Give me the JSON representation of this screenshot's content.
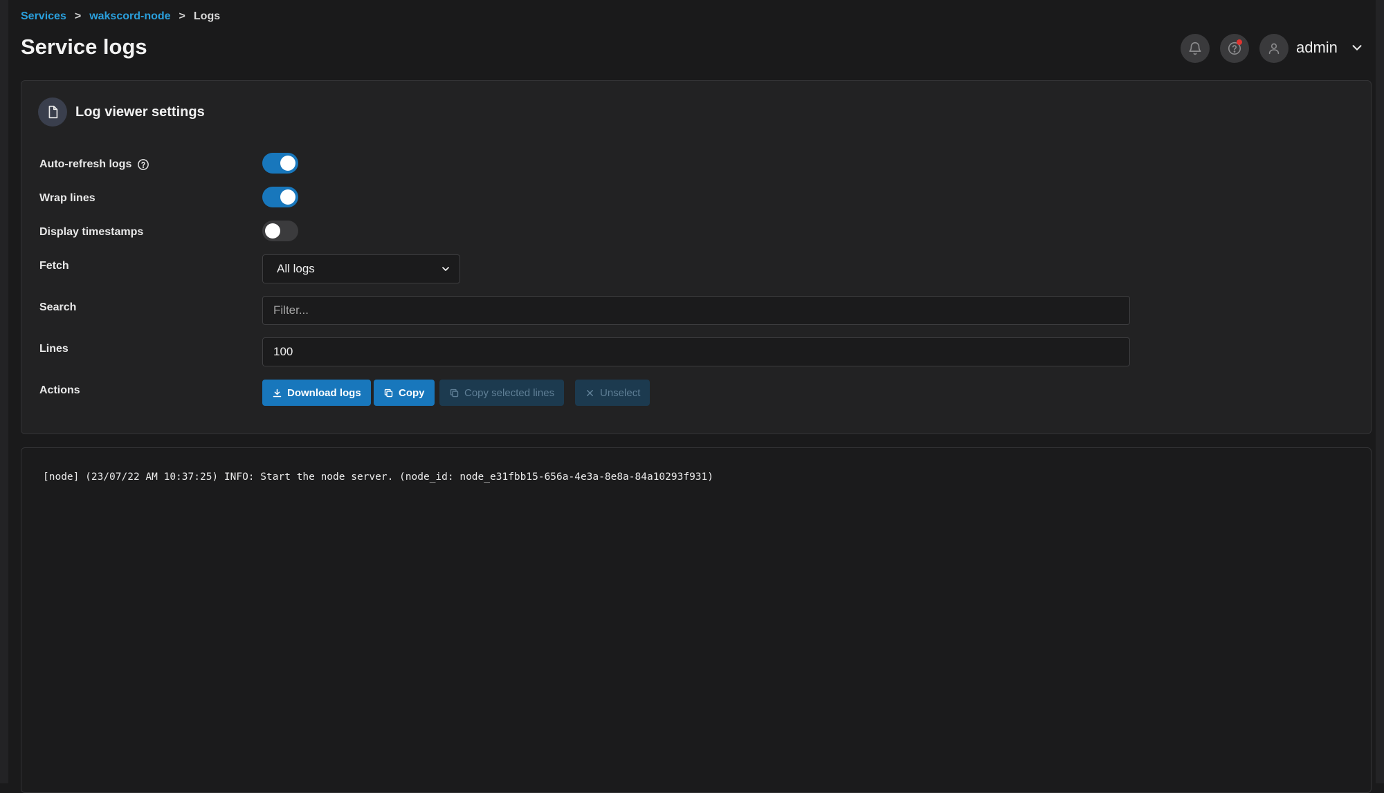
{
  "breadcrumb": {
    "items": [
      "Services",
      "wakscord-node"
    ],
    "separator": ">",
    "current": "Logs"
  },
  "header": {
    "title": "Service logs",
    "user": "admin",
    "icons": [
      "bell-icon",
      "help-circle-icon",
      "user-icon",
      "chevron-down-icon"
    ],
    "notification_color": "#e0342f"
  },
  "settings": {
    "title": "Log viewer settings",
    "auto_refresh": {
      "label": "Auto-refresh logs",
      "enabled": true
    },
    "wrap_lines": {
      "label": "Wrap lines",
      "enabled": true
    },
    "timestamps": {
      "label": "Display timestamps",
      "enabled": false
    },
    "fetch": {
      "label": "Fetch",
      "value": "All logs"
    },
    "search": {
      "label": "Search",
      "placeholder": "Filter...",
      "value": ""
    },
    "lines": {
      "label": "Lines",
      "value": "100"
    },
    "actions": {
      "label": "Actions",
      "download": "Download logs",
      "copy": "Copy",
      "copy_selected": "Copy selected lines",
      "unselect": "Unselect"
    }
  },
  "logs": {
    "lines": [
      "[node] (23/07/22 AM 10:37:25) INFO: Start the node server. (node_id: node_e31fbb15-656a-4e3a-8e8a-84a10293f931)"
    ]
  },
  "colors": {
    "accent": "#1877bc",
    "link": "#2a9fdc",
    "background": "#1a1a1b"
  }
}
